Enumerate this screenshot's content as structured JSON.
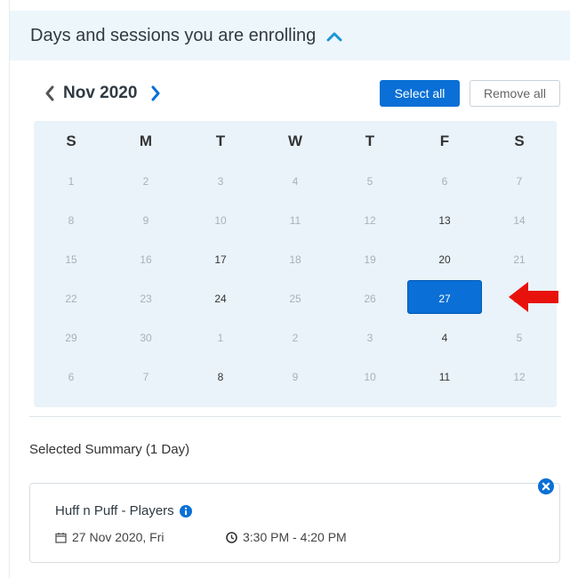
{
  "header": {
    "title": "Days and sessions you are enrolling",
    "collapse_icon": "chevron-up-icon"
  },
  "calendar": {
    "month_label": "Nov 2020",
    "prev_icon": "chevron-left-icon",
    "next_icon": "chevron-right-icon",
    "select_all_label": "Select all",
    "remove_all_label": "Remove all",
    "weekdays": [
      "S",
      "M",
      "T",
      "W",
      "T",
      "F",
      "S"
    ],
    "weeks": [
      [
        {
          "d": "1",
          "s": "disabled"
        },
        {
          "d": "2",
          "s": "disabled"
        },
        {
          "d": "3",
          "s": "disabled"
        },
        {
          "d": "4",
          "s": "disabled"
        },
        {
          "d": "5",
          "s": "disabled"
        },
        {
          "d": "6",
          "s": "disabled"
        },
        {
          "d": "7",
          "s": "disabled"
        }
      ],
      [
        {
          "d": "8",
          "s": "disabled"
        },
        {
          "d": "9",
          "s": "disabled"
        },
        {
          "d": "10",
          "s": "disabled"
        },
        {
          "d": "11",
          "s": "disabled"
        },
        {
          "d": "12",
          "s": "disabled"
        },
        {
          "d": "13",
          "s": "available"
        },
        {
          "d": "14",
          "s": "disabled"
        }
      ],
      [
        {
          "d": "15",
          "s": "disabled"
        },
        {
          "d": "16",
          "s": "disabled"
        },
        {
          "d": "17",
          "s": "available"
        },
        {
          "d": "18",
          "s": "disabled"
        },
        {
          "d": "19",
          "s": "disabled"
        },
        {
          "d": "20",
          "s": "available"
        },
        {
          "d": "21",
          "s": "disabled"
        }
      ],
      [
        {
          "d": "22",
          "s": "disabled"
        },
        {
          "d": "23",
          "s": "disabled"
        },
        {
          "d": "24",
          "s": "available"
        },
        {
          "d": "25",
          "s": "disabled"
        },
        {
          "d": "26",
          "s": "disabled"
        },
        {
          "d": "27",
          "s": "selected"
        },
        {
          "d": "28",
          "s": "disabled"
        }
      ],
      [
        {
          "d": "29",
          "s": "disabled"
        },
        {
          "d": "30",
          "s": "disabled"
        },
        {
          "d": "1",
          "s": "disabled"
        },
        {
          "d": "2",
          "s": "disabled"
        },
        {
          "d": "3",
          "s": "disabled"
        },
        {
          "d": "4",
          "s": "available"
        },
        {
          "d": "5",
          "s": "disabled"
        }
      ],
      [
        {
          "d": "6",
          "s": "disabled"
        },
        {
          "d": "7",
          "s": "disabled"
        },
        {
          "d": "8",
          "s": "available"
        },
        {
          "d": "9",
          "s": "disabled"
        },
        {
          "d": "10",
          "s": "disabled"
        },
        {
          "d": "11",
          "s": "available"
        },
        {
          "d": "12",
          "s": "disabled"
        }
      ]
    ]
  },
  "annotation": {
    "arrow_icon": "red-arrow-icon",
    "color": "#e8120c"
  },
  "summary": {
    "title": "Selected Summary (1 Day)",
    "sessions": [
      {
        "name": "Huff n Puff - Players",
        "date": "27 Nov 2020, Fri",
        "time": "3:30 PM - 4:20 PM"
      }
    ]
  },
  "colors": {
    "accent": "#0a6fd6",
    "header_bg": "#edf6fb",
    "calendar_bg": "#e9f3f9"
  }
}
